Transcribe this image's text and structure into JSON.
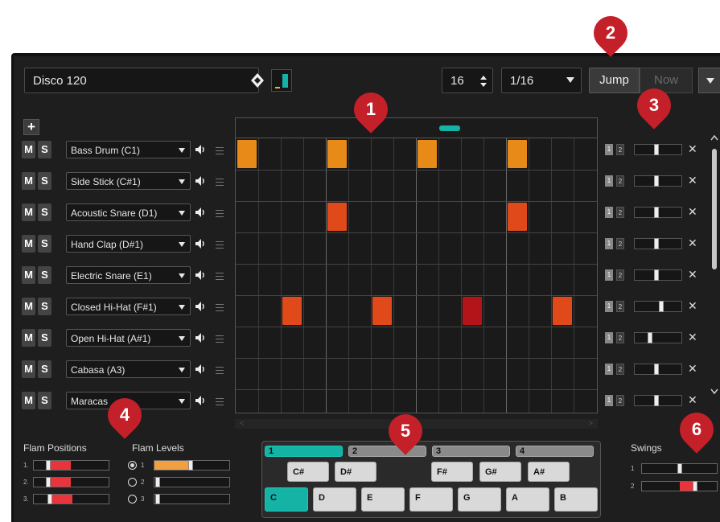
{
  "header": {
    "pattern_name": "Disco 120",
    "steps": "16",
    "resolution": "1/16",
    "jump_label": "Jump",
    "now_label": "Now"
  },
  "add_label": "+",
  "mute_label": "M",
  "solo_label": "S",
  "instruments": [
    {
      "name": "Bass Drum (C1)"
    },
    {
      "name": "Side Stick (C#1)"
    },
    {
      "name": "Acoustic Snare (D1)"
    },
    {
      "name": "Hand Clap (D#1)"
    },
    {
      "name": "Electric Snare (E1)"
    },
    {
      "name": "Closed Hi-Hat (F#1)"
    },
    {
      "name": "Open Hi-Hat (A#1)"
    },
    {
      "name": "Cabasa (A3)"
    },
    {
      "name": "Maracas"
    }
  ],
  "velocity_buttons": [
    "1",
    "2"
  ],
  "close_label": "✕",
  "flam": {
    "positions_label": "Flam Positions",
    "levels_label": "Flam Levels",
    "index_labels": [
      "1.",
      "2.",
      "3."
    ],
    "level_labels": [
      "1",
      "2",
      "3"
    ],
    "levels_fill": [
      0.5,
      0.0,
      0.0
    ],
    "positions_fill": [
      0.25,
      0.25,
      0.3
    ]
  },
  "keyboard": {
    "octaves": [
      "1",
      "2",
      "3",
      "4"
    ],
    "black_keys": [
      "C#",
      "D#",
      "F#",
      "G#",
      "A#"
    ],
    "white_keys": [
      "C",
      "D",
      "E",
      "F",
      "G",
      "A",
      "B"
    ]
  },
  "swings": {
    "label": "Swings",
    "index_labels": [
      "1",
      "2"
    ],
    "values": [
      0.0,
      0.4
    ]
  },
  "callouts": [
    "1",
    "2",
    "3",
    "4",
    "5",
    "6"
  ],
  "colors": {
    "accent": "#15b3a6",
    "step_orange": "#e88a17",
    "step_red_orange": "#e04a1a",
    "step_dark_red": "#b3141a",
    "callout_red": "#c4202a"
  }
}
